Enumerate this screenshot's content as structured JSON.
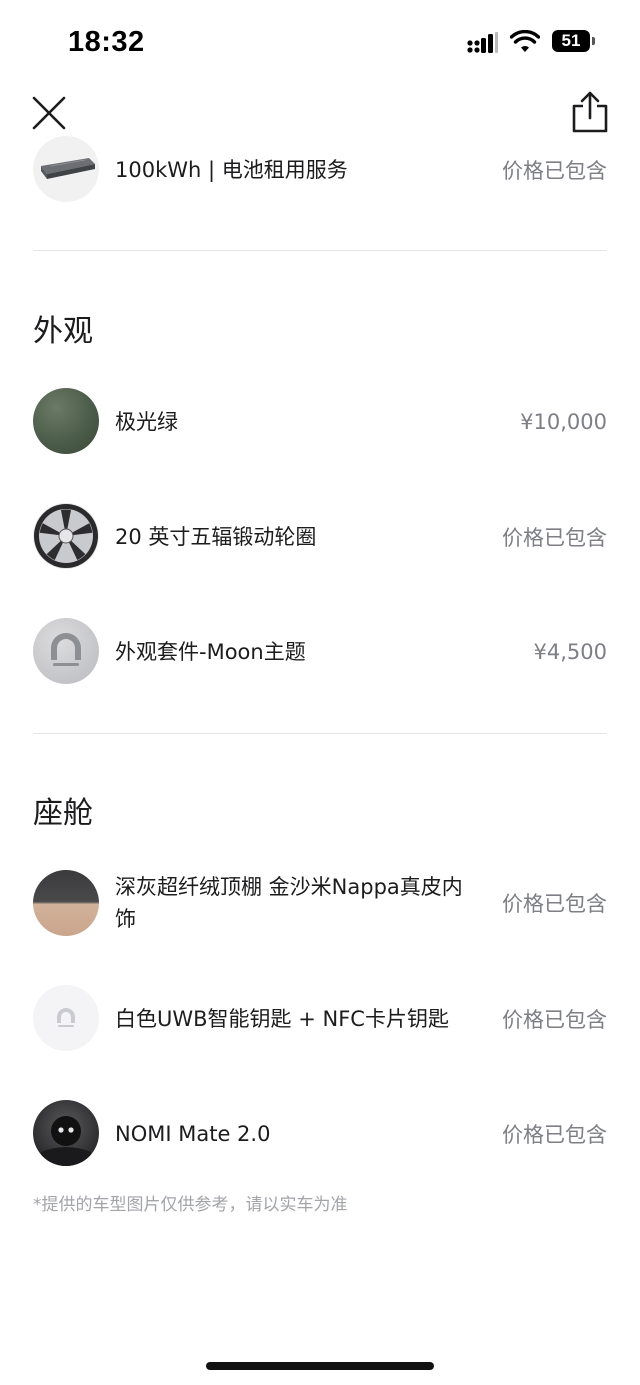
{
  "status_bar": {
    "time": "18:32",
    "battery": "51"
  },
  "battery_row": {
    "name": "100kWh | 电池租用服务",
    "price": "价格已包含"
  },
  "sections": [
    {
      "title": "外观",
      "items": [
        {
          "name": "极光绿",
          "price": "¥10,000"
        },
        {
          "name": "20 英寸五辐锻动轮圈",
          "price": "价格已包含"
        },
        {
          "name": "外观套件-Moon主题",
          "price": "¥4,500"
        }
      ]
    },
    {
      "title": "座舱",
      "items": [
        {
          "name": "深灰超纤绒顶棚 金沙米Nappa真皮内饰",
          "price": "价格已包含"
        },
        {
          "name": "白色UWB智能钥匙 + NFC卡片钥匙",
          "price": "价格已包含"
        },
        {
          "name": "NOMI Mate 2.0",
          "price": "价格已包含"
        }
      ]
    }
  ],
  "footnote": "*提供的车型图片仅供参考，请以实车为准",
  "icons": {
    "close": "close-icon",
    "share": "share-icon",
    "signal": "cellular-signal-icon",
    "wifi": "wifi-icon",
    "battery": "battery-icon"
  },
  "colors": {
    "aurora_green": "#4a5a48",
    "price_gray": "#7d7f85",
    "divider": "#e6e6e8"
  }
}
